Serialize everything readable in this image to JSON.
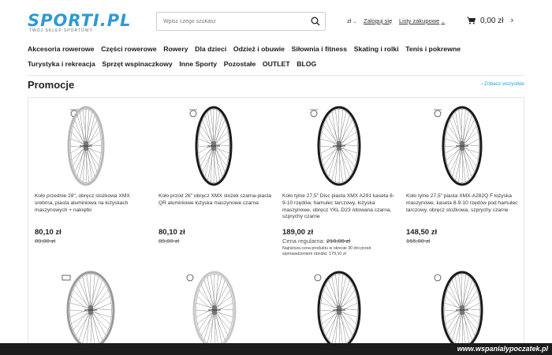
{
  "logo": {
    "text": "SPORTI.PL",
    "tagline": "TWÓJ SKLEP SPORTOWY"
  },
  "search": {
    "placeholder": "Wpisz czego szukasz"
  },
  "header": {
    "currency": "zł",
    "login": "Zaloguj się",
    "lists": "Listy zakupowe",
    "cart_total": "0,00 zł"
  },
  "nav": {
    "row1": [
      "Akcesoria rowerowe",
      "Części rowerowe",
      "Rowery",
      "Dla dzieci",
      "Odzież i obuwie",
      "Siłownia i fitness",
      "Skating i rolki",
      "Tenis i pokrewne"
    ],
    "row2": [
      "Turystyka i rekreacja",
      "Sprzęt wspinaczkowy",
      "Inne Sporty",
      "Pozostałe",
      "OUTLET",
      "BLOG"
    ]
  },
  "section": {
    "title": "Promocje",
    "see_all": "Zobacz wszystkie"
  },
  "products": [
    {
      "name": "Koło przednie 28\", obręcz stożkowa XMX srebrna, piasta aluminiowa na łożyskach maszynowych + nakrętki",
      "price": "80,10 zł",
      "old_price": "89,00 zł",
      "rim_color": "#b9b9b9"
    },
    {
      "name": "Koło przód 26\" obręcz XMX stożek czarna-piasta QR aluminiowe łożyska maszynowe czarna",
      "price": "80,10 zł",
      "old_price": "89,00 zł",
      "rim_color": "#1a1a1a"
    },
    {
      "name": "Koło tylne 27,5\" Disc piasta XMX A291 kaseta 8-9-10 rzędów, hamulec tarczowy, łożyska maszynowe, obręcz YKL-D23 nitowana czarna, szprychy czarne",
      "price": "189,00 zł",
      "regular_label": "Cena regularna:",
      "regular_price": "210,00 zł",
      "lowest_note": "Najniższa cena produktu w okresie 30 dni przed wprowadzeniem obniżki: 179,10 zł",
      "rim_color": "#1a1a1a"
    },
    {
      "name": "Koło tylne 27,5\" piasta XMX-A282Q F łożyska maszynowe, kaseta 8-9-10 rzędów pod hamulec tarczowy, obręcz stożkowa, szprychy czarne",
      "price": "148,50 zł",
      "old_price": "165,00 zł",
      "rim_color": "#1a1a1a"
    }
  ],
  "products_row2": [
    {
      "rim_color": "#9a9a9a"
    },
    {
      "rim_color": "#c8c8c8"
    },
    {
      "rim_color": "#1a1a1a"
    },
    {
      "rim_color": "#1a1a1a"
    }
  ],
  "watermark": "www.wspanialypoczatek.pl",
  "colors": {
    "accent": "#2d9ad6",
    "text": "#222222"
  }
}
